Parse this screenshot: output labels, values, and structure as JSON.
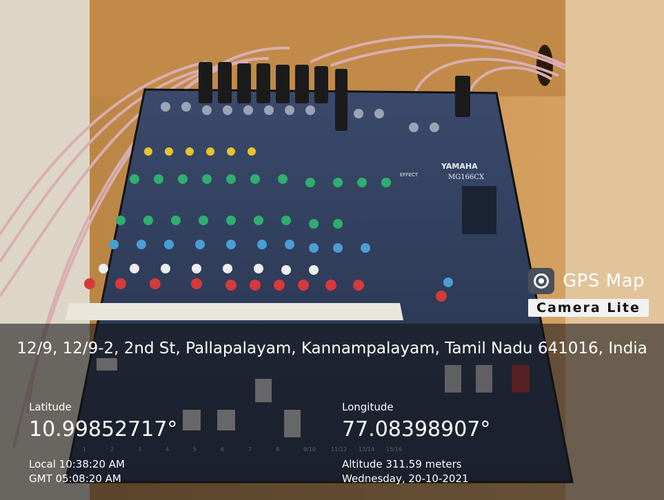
{
  "watermark": {
    "icon": "camera-lens-icon",
    "title": "GPS Map",
    "subtitle": "Camera Lite"
  },
  "mixer": {
    "brand": "YAMAHA",
    "model": "MG166CX",
    "channel_strip_labels": [
      "1",
      "2",
      "3",
      "4",
      "5",
      "6",
      "7",
      "8",
      "9/10",
      "11/12",
      "13/14",
      "15/16"
    ],
    "effect_label": "EFFECT"
  },
  "location": {
    "address": "12/9, 12/9-2, 2nd St, Pallapalayam, Kannampalayam, Tamil Nadu 641016, India",
    "latitude_label": "Latitude",
    "latitude": "10.99852717°",
    "longitude_label": "Longitude",
    "longitude": "77.08398907°",
    "local_time": "Local 10:38:20 AM",
    "gmt_time": "GMT 05:08:20 AM",
    "altitude": "Altitude 311.59 meters",
    "date": "Wednesday, 20-10-2021"
  }
}
